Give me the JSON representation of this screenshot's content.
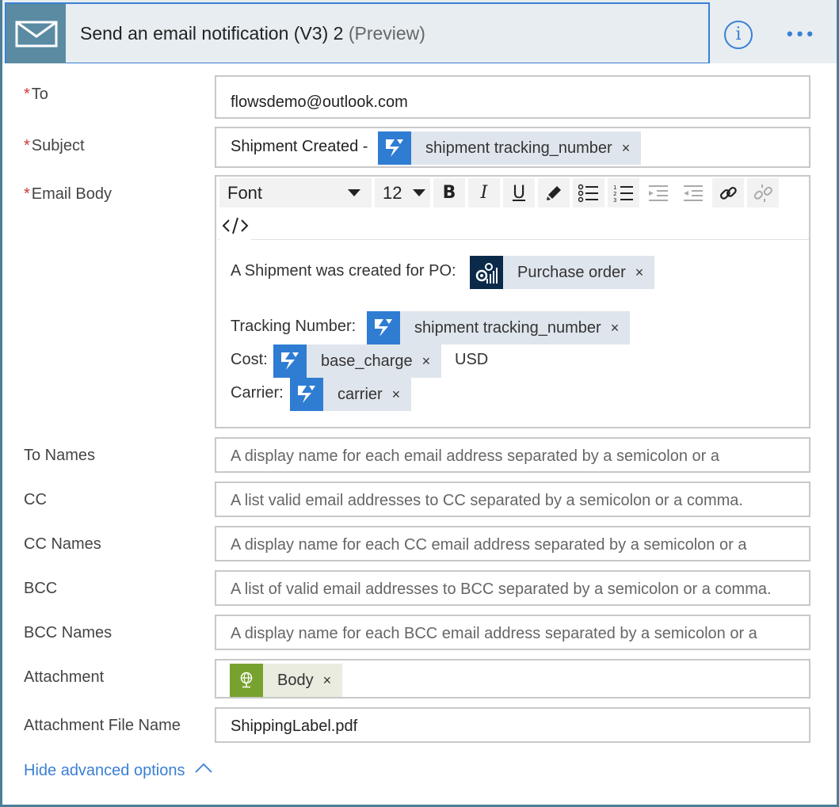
{
  "header": {
    "title": "Send an email notification (V3) 2",
    "preview": "(Preview)",
    "info_label": "i",
    "more_label": "•••"
  },
  "fields": {
    "to": {
      "label": "To",
      "required": "*",
      "value": "flowsdemo@outlook.com"
    },
    "subject": {
      "label": "Subject",
      "required": "*",
      "prefix": "Shipment Created -",
      "token": {
        "label": "shipment tracking_number",
        "icon": "shippo-icon"
      }
    },
    "email_body": {
      "label": "Email Body",
      "required": "*"
    },
    "to_names": {
      "label": "To Names",
      "placeholder": "A display name for each email address separated by a semicolon or a"
    },
    "cc": {
      "label": "CC",
      "placeholder": "A list valid email addresses to CC separated by a semicolon or a comma."
    },
    "cc_names": {
      "label": "CC Names",
      "placeholder": "A display name for each CC email address separated by a semicolon or a"
    },
    "bcc": {
      "label": "BCC",
      "placeholder": "A list of valid email addresses to BCC separated by a semicolon or a comma."
    },
    "bcc_names": {
      "label": "BCC Names",
      "placeholder": "A display name for each BCC email address separated by a semicolon or a"
    },
    "attachment": {
      "label": "Attachment",
      "token": {
        "label": "Body",
        "icon": "http-globe-icon"
      }
    },
    "attachment_file_name": {
      "label": "Attachment File Name",
      "value": "ShippingLabel.pdf"
    }
  },
  "toolbar": {
    "font": "Font",
    "size": "12",
    "buttons": [
      "bold",
      "italic",
      "underline",
      "font-color",
      "bullet-list",
      "numbered-list",
      "decrease-indent",
      "increase-indent",
      "link",
      "unlink",
      "code-view"
    ]
  },
  "body": {
    "line1": "A Shipment was created for PO:",
    "po_token": "Purchase order",
    "tracking_label": "Tracking Number:",
    "tracking_token": "shipment tracking_number",
    "cost_label": "Cost:",
    "cost_token": "base_charge",
    "cost_suffix": "USD",
    "carrier_label": "Carrier:",
    "carrier_token": "carrier"
  },
  "close_glyph": "×",
  "footer": {
    "advanced_link": "Hide advanced options"
  },
  "colors": {
    "accent": "#3a7fd5",
    "header_bg": "#e7edf1",
    "mail_tile": "#5a8ba3",
    "token_bg": "#dfe5ec",
    "shippo": "#2f7cd3",
    "required": "#d13438"
  }
}
